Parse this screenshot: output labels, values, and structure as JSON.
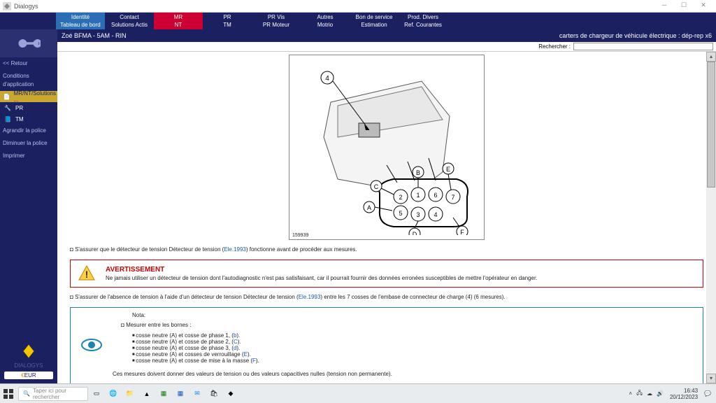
{
  "window": {
    "title": "Dialogys"
  },
  "topmenu": [
    {
      "l1": "Identité",
      "l2": "Tableau de bord",
      "cls": "hl"
    },
    {
      "l1": "Contact",
      "l2": "Solutions Actis",
      "cls": ""
    },
    {
      "l1": "MR",
      "l2": "NT",
      "cls": "active"
    },
    {
      "l1": "PR",
      "l2": "TM",
      "cls": ""
    },
    {
      "l1": "PR Vis",
      "l2": "PR Moteur",
      "cls": ""
    },
    {
      "l1": "Autres",
      "l2": "Motrio",
      "cls": ""
    },
    {
      "l1": "Bon de service",
      "l2": "Estimation",
      "cls": ""
    },
    {
      "l1": "Prod. Divers",
      "l2": "Ref. Courantes",
      "cls": ""
    }
  ],
  "sidebar": {
    "nav": [
      {
        "label": "<< Retour"
      },
      {
        "label": "Conditions d'application"
      }
    ],
    "tabs": [
      {
        "label": "MR/NT/Solutions ...",
        "active": true
      },
      {
        "label": "PR",
        "active": false
      },
      {
        "label": "TM",
        "active": false
      }
    ],
    "nav2": [
      {
        "label": "Agrandir la police"
      },
      {
        "label": "Diminuer la police"
      },
      {
        "label": "Imprimer"
      }
    ],
    "brandlabel": "DIALOGYS",
    "currency": "EUR"
  },
  "crumb": {
    "left": "Zoé BFMA - 5AM - RIN",
    "right": "carters de chargeur de véhicule électrique : dép-rep x6"
  },
  "search": {
    "label": "Rechercher :",
    "value": ""
  },
  "figure": {
    "num": "159939"
  },
  "body": {
    "p1a": "S'assurer que le détecteur de tension Détecteur de tension (",
    "p1link": "Ele.1993",
    "p1b": ") fonctionne avant de procéder aux mesures.",
    "warn": {
      "title": "AVERTISSEMENT",
      "text": "Ne jamais utiliser un détecteur de tension dont l'autodiagnostic n'est pas satisfaisant, car il pourrait fournir des données erronées susceptibles de mettre l'opérateur en danger."
    },
    "p2a": "S'assurer de l'absence de tension à l'aide d'un détecteur de tension Détecteur de tension (",
    "p2link": "Ele.1993",
    "p2b": ") entre les 7 cosses de l'embase de connecteur de charge (4) (6 mesures).",
    "note": {
      "heading": "Nota:",
      "intro": "Mesurer entre les bornes :",
      "items": [
        {
          "a": "cosse neutre (A) et cosse de phase 1, (",
          "l": "b",
          "b": ")."
        },
        {
          "a": "cosse neutre (A) et cosse de phase 2, (",
          "l": "C",
          "b": ")."
        },
        {
          "a": "cosse neutre (A) et cosse de phase 3, (",
          "l": "d",
          "b": ")."
        },
        {
          "a": "cosse neutre (A) et cosses de verrouillage (",
          "l": "E",
          "b": ")."
        },
        {
          "a": "cosse neutre (A) et cosse de mise à la masse (",
          "l": "F",
          "b": ")."
        }
      ],
      "closing": "Ces mesures doivent donner des valeurs de tension ou des valeurs capacitives nulles (tension non permanente)."
    }
  },
  "taskbar": {
    "searchPlaceholder": "Taper ici pour rechercher",
    "clock": {
      "time": "16:43",
      "date": "20/12/2023"
    }
  }
}
